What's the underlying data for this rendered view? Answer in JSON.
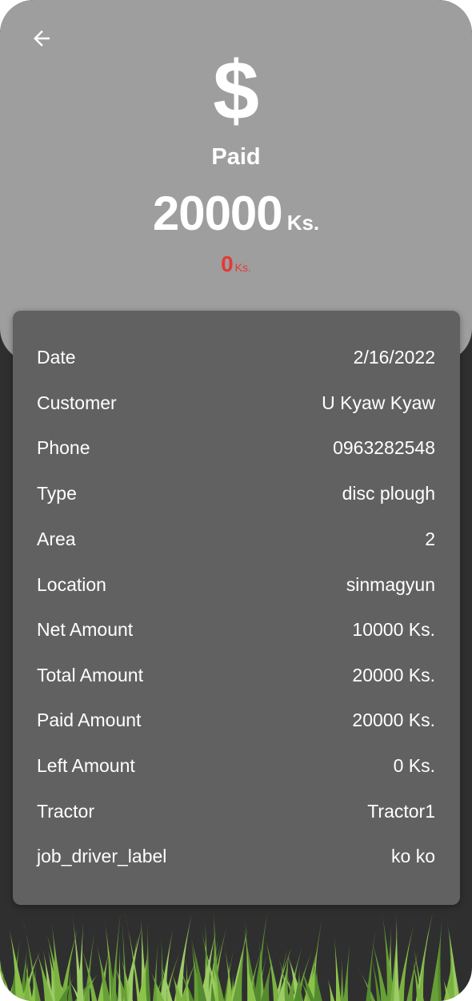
{
  "header": {
    "back_icon": "arrow-left-icon",
    "currency_icon": "$",
    "status": "Paid",
    "amount": "20000",
    "amount_unit": "Ks.",
    "left_amount": "0",
    "left_unit": "Ks.",
    "left_color": "#e53935"
  },
  "details": [
    {
      "label": "Date",
      "value": "2/16/2022"
    },
    {
      "label": "Customer",
      "value": "U Kyaw Kyaw"
    },
    {
      "label": "Phone",
      "value": "0963282548"
    },
    {
      "label": "Type",
      "value": "disc plough"
    },
    {
      "label": "Area",
      "value": "2"
    },
    {
      "label": "Location",
      "value": "sinmagyun"
    },
    {
      "label": "Net Amount",
      "value": "10000 Ks."
    },
    {
      "label": "Total Amount",
      "value": "20000 Ks."
    },
    {
      "label": "Paid Amount",
      "value": "20000 Ks."
    },
    {
      "label": "Left Amount",
      "value": "0 Ks."
    },
    {
      "label": "Tractor",
      "value": "Tractor1"
    },
    {
      "label": "job_driver_label",
      "value": "ko ko"
    }
  ],
  "colors": {
    "header_bg": "#9e9e9e",
    "card_bg": "#616161",
    "page_bg": "#2f2f2f",
    "grass": "#8bc34a"
  }
}
